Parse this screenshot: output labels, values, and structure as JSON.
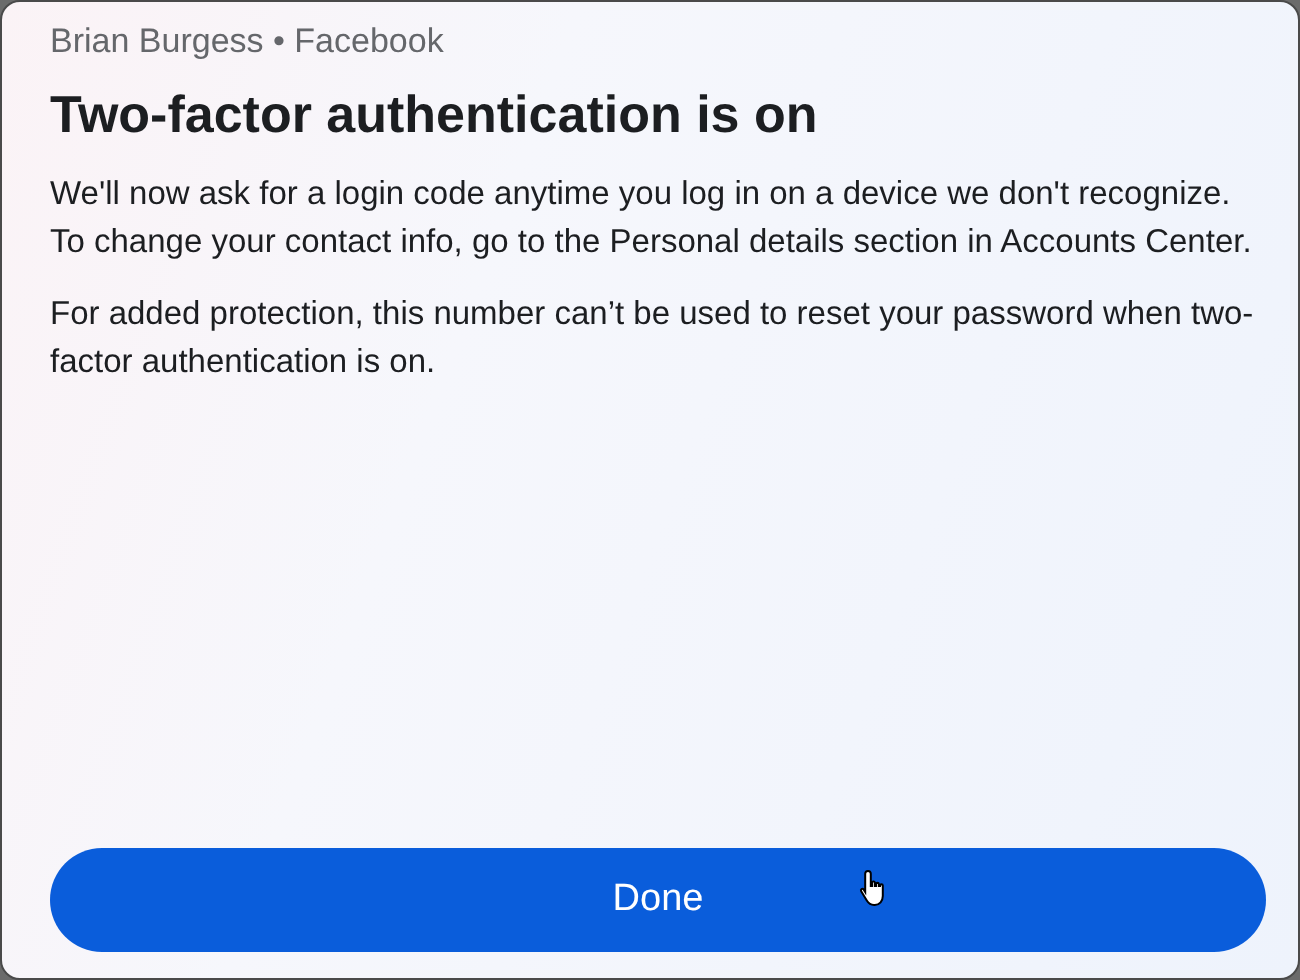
{
  "header": {
    "account": "Brian Burgess • Facebook"
  },
  "title": "Two-factor authentication is on",
  "paragraphs": [
    "We'll now ask for a login code anytime you log in on a device we don't recognize. To change your contact info, go to the Personal details section in Accounts Center.",
    "For added protection, this number can’t be used to reset your password when two-factor authentication is on."
  ],
  "button": {
    "label": "Done"
  }
}
